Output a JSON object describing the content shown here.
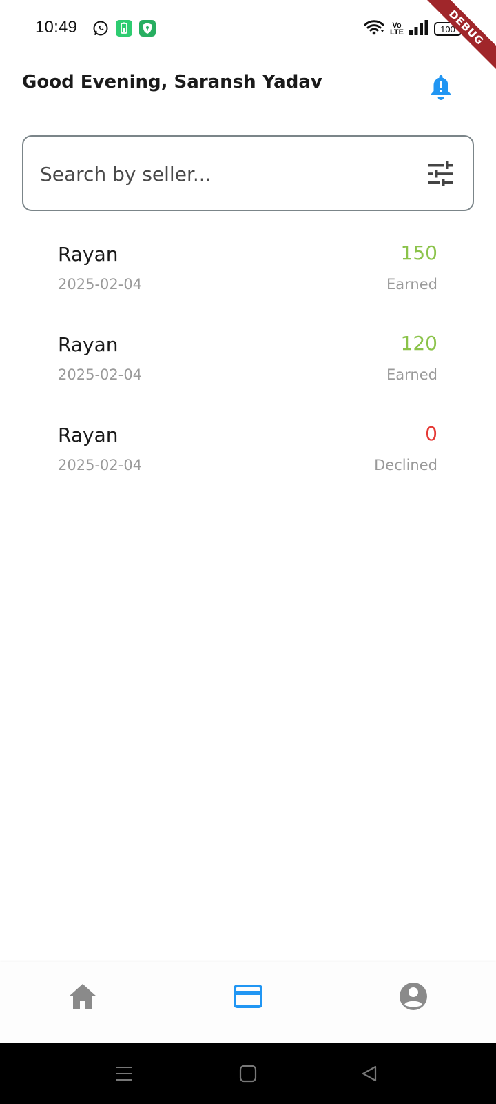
{
  "status_bar": {
    "time": "10:49",
    "battery": "100",
    "network": "LTE",
    "network_top": "Vo",
    "app_icons": [
      "whatsapp-icon",
      "battery-saver-icon",
      "shield-icon"
    ]
  },
  "debug_banner": "DEBUG",
  "header": {
    "greeting": "Good Evening, Saransh Yadav",
    "bell_color": "#2196F3"
  },
  "search": {
    "placeholder": "Search by seller..."
  },
  "transactions": [
    {
      "name": "Rayan",
      "date": "2025-02-04",
      "amount": "150",
      "status": "Earned",
      "color": "#8BC34A"
    },
    {
      "name": "Rayan",
      "date": "2025-02-04",
      "amount": "120",
      "status": "Earned",
      "color": "#8BC34A"
    },
    {
      "name": "Rayan",
      "date": "2025-02-04",
      "amount": "0",
      "status": "Declined",
      "color": "#E53935"
    }
  ],
  "bottom_nav": {
    "items": [
      {
        "icon": "home-icon",
        "active": false
      },
      {
        "icon": "card-icon",
        "active": true
      },
      {
        "icon": "account-icon",
        "active": false
      }
    ],
    "active_color": "#2196F3",
    "inactive_color": "#8a8a8a"
  }
}
